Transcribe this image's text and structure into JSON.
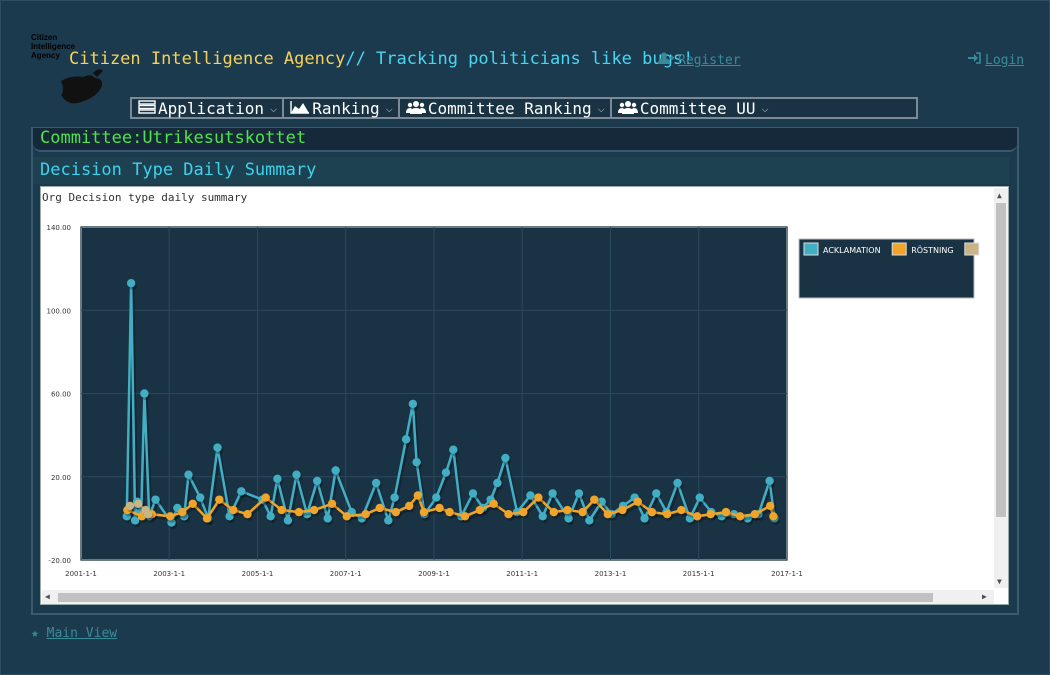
{
  "header": {
    "logo_text": "Citizen Intelligence Agency",
    "title_main": "Citizen Intelligence Agency",
    "title_tagline": "// Tracking politicians like bugs!",
    "register_label": "Register",
    "login_label": "Login"
  },
  "menu": [
    {
      "label": "Application",
      "icon": "server-icon"
    },
    {
      "label": "Ranking",
      "icon": "area-chart-icon"
    },
    {
      "label": "Committee Ranking",
      "icon": "users-icon"
    },
    {
      "label": "Committee UU",
      "icon": "users-icon"
    }
  ],
  "committee_title": "Committee:Utrikesutskottet",
  "section_title": "Decision Type Daily Summary",
  "chart_caption": "Org Decision type daily summary",
  "footer": {
    "main_view_label": "Main View"
  },
  "colors": {
    "acklamation": "#41aec4",
    "rostning": "#f0a42a",
    "other": "#c8b484",
    "plot_bg": "#1a3344"
  },
  "chart_data": {
    "type": "line",
    "title": "Org Decision type daily summary",
    "ylim": [
      -20,
      140
    ],
    "yticks": [
      "140.00",
      "100.00",
      "60.00",
      "20.00",
      "-20.00"
    ],
    "xticks": [
      "2001-1-1",
      "2003-1-1",
      "2005-1-1",
      "2007-1-1",
      "2009-1-1",
      "2011-1-1",
      "2013-1-1",
      "2015-1-1",
      "2017-1-1"
    ],
    "xlim": [
      "2001-01-01",
      "2017-01-01"
    ],
    "grid": true,
    "legend_position": "top-right",
    "series": [
      {
        "name": "ACKLAMATION",
        "points": [
          [
            "2002-01-15",
            1
          ],
          [
            "2002-02-20",
            113
          ],
          [
            "2002-03-25",
            -1
          ],
          [
            "2002-04-10",
            8
          ],
          [
            "2002-05-15",
            3
          ],
          [
            "2002-06-10",
            60
          ],
          [
            "2002-07-20",
            1
          ],
          [
            "2002-09-10",
            9
          ],
          [
            "2003-01-20",
            -2
          ],
          [
            "2003-03-10",
            5
          ],
          [
            "2003-05-05",
            1
          ],
          [
            "2003-06-10",
            21
          ],
          [
            "2003-09-15",
            10
          ],
          [
            "2003-11-20",
            0
          ],
          [
            "2004-02-05",
            34
          ],
          [
            "2004-05-15",
            1
          ],
          [
            "2004-08-20",
            13
          ],
          [
            "2005-02-10",
            9
          ],
          [
            "2005-04-20",
            1
          ],
          [
            "2005-06-15",
            19
          ],
          [
            "2005-09-10",
            -1
          ],
          [
            "2005-11-20",
            21
          ],
          [
            "2006-02-15",
            2
          ],
          [
            "2006-05-10",
            18
          ],
          [
            "2006-08-05",
            0
          ],
          [
            "2006-10-10",
            23
          ],
          [
            "2007-02-20",
            3
          ],
          [
            "2007-05-15",
            0
          ],
          [
            "2007-09-10",
            17
          ],
          [
            "2007-12-20",
            -1
          ],
          [
            "2008-02-10",
            10
          ],
          [
            "2008-05-15",
            38
          ],
          [
            "2008-07-10",
            55
          ],
          [
            "2008-08-10",
            27
          ],
          [
            "2008-10-15",
            2
          ],
          [
            "2009-01-20",
            10
          ],
          [
            "2009-04-10",
            22
          ],
          [
            "2009-06-10",
            33
          ],
          [
            "2009-08-15",
            1
          ],
          [
            "2009-11-20",
            12
          ],
          [
            "2010-02-10",
            5
          ],
          [
            "2010-04-15",
            9
          ],
          [
            "2010-06-10",
            17
          ],
          [
            "2010-08-15",
            29
          ],
          [
            "2010-11-20",
            3
          ],
          [
            "2011-03-10",
            11
          ],
          [
            "2011-06-20",
            1
          ],
          [
            "2011-09-10",
            12
          ],
          [
            "2012-01-20",
            0
          ],
          [
            "2012-04-15",
            12
          ],
          [
            "2012-07-10",
            -1
          ],
          [
            "2012-10-20",
            8
          ],
          [
            "2013-01-10",
            2
          ],
          [
            "2013-04-15",
            6
          ],
          [
            "2013-07-20",
            10
          ],
          [
            "2013-10-10",
            0
          ],
          [
            "2014-01-15",
            12
          ],
          [
            "2014-04-10",
            3
          ],
          [
            "2014-07-10",
            17
          ],
          [
            "2014-10-20",
            0
          ],
          [
            "2015-01-10",
            10
          ],
          [
            "2015-04-15",
            3
          ],
          [
            "2015-07-10",
            1
          ],
          [
            "2015-10-20",
            2
          ],
          [
            "2016-02-10",
            0
          ],
          [
            "2016-05-10",
            2
          ],
          [
            "2016-08-10",
            18
          ],
          [
            "2016-09-20",
            0
          ]
        ]
      },
      {
        "name": "RÖSTNING",
        "points": [
          [
            "2002-01-20",
            4
          ],
          [
            "2002-05-20",
            1
          ],
          [
            "2002-08-10",
            2
          ],
          [
            "2003-01-10",
            1
          ],
          [
            "2003-04-20",
            3
          ],
          [
            "2003-07-15",
            7
          ],
          [
            "2003-11-10",
            0
          ],
          [
            "2004-02-20",
            9
          ],
          [
            "2004-06-15",
            4
          ],
          [
            "2004-10-10",
            2
          ],
          [
            "2005-03-10",
            10
          ],
          [
            "2005-07-20",
            4
          ],
          [
            "2005-12-10",
            3
          ],
          [
            "2006-04-15",
            4
          ],
          [
            "2006-09-10",
            7
          ],
          [
            "2007-01-10",
            1
          ],
          [
            "2007-06-15",
            2
          ],
          [
            "2007-10-10",
            5
          ],
          [
            "2008-02-20",
            3
          ],
          [
            "2008-06-10",
            6
          ],
          [
            "2008-08-20",
            11
          ],
          [
            "2008-10-10",
            3
          ],
          [
            "2009-02-15",
            5
          ],
          [
            "2009-05-10",
            3
          ],
          [
            "2009-09-15",
            1
          ],
          [
            "2010-01-15",
            4
          ],
          [
            "2010-05-10",
            7
          ],
          [
            "2010-09-10",
            2
          ],
          [
            "2011-01-10",
            3
          ],
          [
            "2011-05-15",
            10
          ],
          [
            "2011-09-20",
            3
          ],
          [
            "2012-01-10",
            4
          ],
          [
            "2012-05-15",
            3
          ],
          [
            "2012-08-20",
            9
          ],
          [
            "2012-12-10",
            2
          ],
          [
            "2013-04-10",
            4
          ],
          [
            "2013-08-15",
            8
          ],
          [
            "2013-12-10",
            3
          ],
          [
            "2014-04-15",
            2
          ],
          [
            "2014-08-10",
            4
          ],
          [
            "2014-12-20",
            1
          ],
          [
            "2015-04-10",
            2
          ],
          [
            "2015-08-15",
            3
          ],
          [
            "2015-12-10",
            1
          ],
          [
            "2016-04-10",
            2
          ],
          [
            "2016-08-15",
            6
          ],
          [
            "2016-09-10",
            1
          ]
        ]
      },
      {
        "name": "-",
        "points": [
          [
            "2002-02-10",
            6
          ],
          [
            "2002-04-20",
            7
          ],
          [
            "2002-06-20",
            4
          ],
          [
            "2002-07-10",
            2
          ]
        ]
      }
    ]
  }
}
